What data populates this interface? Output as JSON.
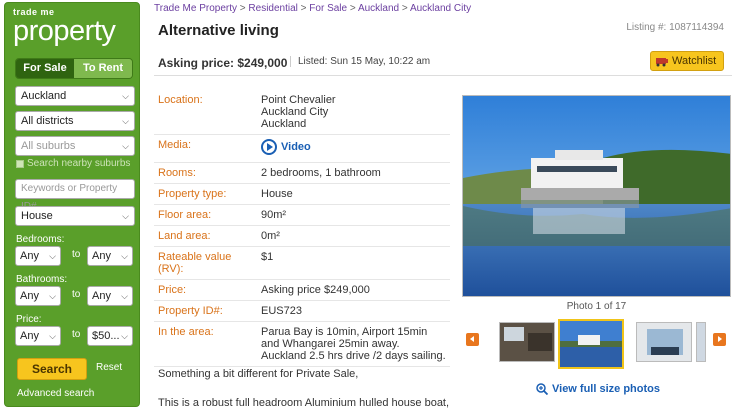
{
  "sidebar": {
    "logo_top": "trade me",
    "logo_main": "property",
    "for_sale": "For Sale",
    "to_rent": "To Rent",
    "region": "Auckland",
    "district": "All districts",
    "suburb": "All suburbs",
    "nearby": "Search nearby suburbs",
    "keywords_placeholder": "Keywords or Property ID#",
    "property_type": "House",
    "bedrooms_label": "Bedrooms:",
    "bedrooms_min": "Any",
    "bedrooms_max": "Any",
    "bathrooms_label": "Bathrooms:",
    "bathrooms_min": "Any",
    "bathrooms_max": "Any",
    "price_label": "Price:",
    "price_min": "Any",
    "price_max": "$50...",
    "to": "to",
    "search": "Search",
    "reset": "Reset",
    "advanced": "Advanced search"
  },
  "breadcrumb": [
    "Trade Me Property",
    "Residential",
    "For Sale",
    "Auckland",
    "Auckland City"
  ],
  "breadcrumb_sep": " > ",
  "title": "Alternative living",
  "listing_no": "Listing #: 1087114394",
  "asking": "Asking price: $249,000",
  "listed": "Listed: Sun 15 May, 10:22 am",
  "watchlist": "Watchlist",
  "attrs": [
    {
      "k": "Location:",
      "v": [
        "Point Chevalier",
        "Auckland City",
        "Auckland"
      ]
    },
    {
      "k": "Media:",
      "v": [
        "Video"
      ]
    },
    {
      "k": "Rooms:",
      "v": [
        "2 bedrooms, 1 bathroom"
      ]
    },
    {
      "k": "Property type:",
      "v": [
        "House"
      ]
    },
    {
      "k": "Floor area:",
      "v": [
        "90m²"
      ]
    },
    {
      "k": "Land area:",
      "v": [
        "0m²"
      ]
    },
    {
      "k": "Rateable value (RV):",
      "v": [
        "$1"
      ]
    },
    {
      "k": "Price:",
      "v": [
        "Asking price $249,000"
      ]
    },
    {
      "k": "Property ID#:",
      "v": [
        "EUS723"
      ]
    },
    {
      "k": "In the area:",
      "v": [
        "Parua Bay is 10min, Airport 15min and Whangarei 25min away. Auckland 2.5 hrs drive /2 days sailing."
      ]
    }
  ],
  "desc1": "Something a bit different for Private Sale,",
  "desc2": "This is a robust full headroom Aluminium hulled house boat,",
  "photo_caption": "Photo 1 of 17",
  "full_size": "View full size photos",
  "colors": {
    "green": "#5a9f2a",
    "orange": "#d9731a",
    "link": "#1a5fb4",
    "yellow": "#f7c51e"
  }
}
